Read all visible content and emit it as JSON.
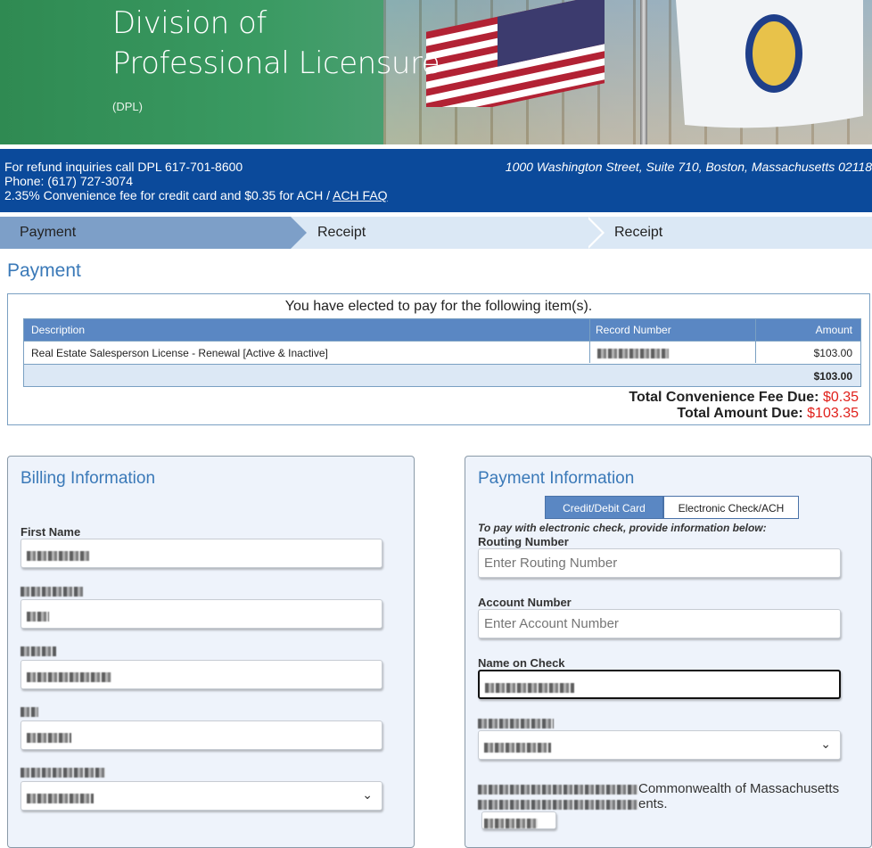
{
  "banner": {
    "title_line1": "Division of",
    "title_line2": "Professional Licensure",
    "abbr": "(DPL)"
  },
  "infobar": {
    "refund": "For refund inquiries call DPL 617-701-8600",
    "phone": "Phone: (617) 727-3074",
    "fee_text": "2.35% Convenience fee for credit card and $0.35 for ACH / ",
    "ach_faq": "ACH FAQ",
    "address": "1000 Washington Street, Suite 710, Boston, Massachusetts 02118"
  },
  "steps": [
    "Payment",
    "Receipt",
    "Receipt"
  ],
  "page_title": "Payment",
  "summary": {
    "intro": "You have elected to pay for the following item(s).",
    "columns": [
      "Description",
      "Record Number",
      "Amount"
    ],
    "row": {
      "description": "Real Estate Salesperson License - Renewal [Active & Inactive]",
      "amount": "$103.00"
    },
    "subtotal": "$103.00",
    "fee_label": "Total Convenience Fee Due: ",
    "fee_value": "$0.35",
    "total_label": "Total Amount Due: ",
    "total_value": "$103.35"
  },
  "billing": {
    "title": "Billing Information",
    "first_name_label": "First Name"
  },
  "payment": {
    "title": "Payment Information",
    "tab_cc": "Credit/Debit Card",
    "tab_ach": "Electronic Check/ACH",
    "ach_note": "To pay with electronic check, provide information below:",
    "routing_label": "Routing Number",
    "routing_placeholder": "Enter Routing Number",
    "account_label": "Account Number",
    "account_placeholder": "Enter Account Number",
    "name_label": "Name on Check",
    "note_tail1": "Commonwealth of Massachusetts",
    "note_tail2": "ents."
  }
}
